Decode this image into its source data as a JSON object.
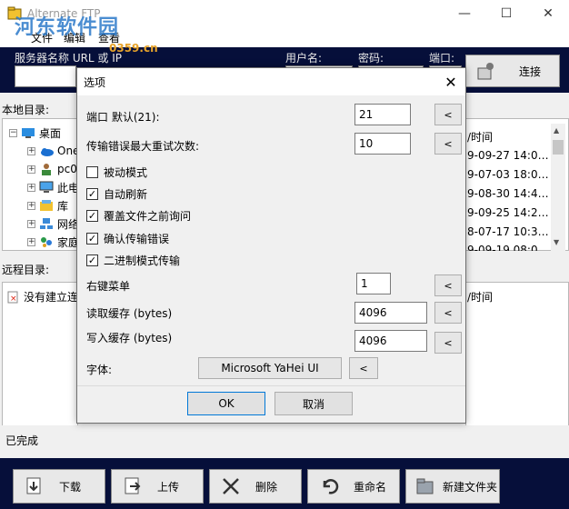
{
  "window": {
    "title": "Alternate FTP",
    "minimize": "—",
    "maximize": "☐",
    "close": "✕"
  },
  "menu": {
    "items": [
      "文件",
      "编辑",
      "查看"
    ]
  },
  "connection": {
    "server_label": "服务器名称 URL 或 IP",
    "user_label": "用户名:",
    "password_label": "密码:",
    "port_label": "端口:",
    "connect_label": "连接"
  },
  "local": {
    "label": "本地目录:",
    "tree": [
      "桌面",
      "One",
      "pc0",
      "此电",
      "库",
      "网络",
      "家庭"
    ],
    "times_header": "/时间",
    "times": [
      "9-09-27 14:0…",
      "9-07-03 18:0…",
      "9-08-30 14:4…",
      "9-09-25 14:2…",
      "8-07-17 10:3…",
      "9-09-19 08:0…"
    ]
  },
  "remote": {
    "label": "远程目录:",
    "not_connected": "没有建立连",
    "times_header": "/时间"
  },
  "status": {
    "text": "已完成"
  },
  "toolbar": {
    "download": "下载",
    "upload": "上传",
    "delete": "删除",
    "rename": "重命名",
    "new_folder": "新建文件夹"
  },
  "dialog": {
    "title": "选项",
    "close": "✕",
    "port_label": "端口 默认(21):",
    "port_value": "21",
    "retry_label": "传输错误最大重试次数:",
    "retry_value": "10",
    "checkboxes": [
      {
        "label": "被动模式",
        "checked": false
      },
      {
        "label": "自动刷新",
        "checked": true
      },
      {
        "label": "覆盖文件之前询问",
        "checked": true
      },
      {
        "label": "确认传输错误",
        "checked": true
      },
      {
        "label": "二进制模式传输",
        "checked": true
      }
    ],
    "context_menu_label": "右键菜单",
    "context_menu_value": "1",
    "read_buffer_label": "读取缓存 (bytes)",
    "read_buffer_value": "4096",
    "write_buffer_label": "写入缓存 (bytes)",
    "write_buffer_value": "4096",
    "font_label": "字体:",
    "font_value": "Microsoft YaHei UI",
    "arrow": "<",
    "ok": "OK",
    "cancel": "取消"
  },
  "watermark": {
    "text": "河东软件园",
    "url": "0359.cn"
  },
  "colors": {
    "dark_band": "#060f3a",
    "accent": "#0078d7"
  }
}
